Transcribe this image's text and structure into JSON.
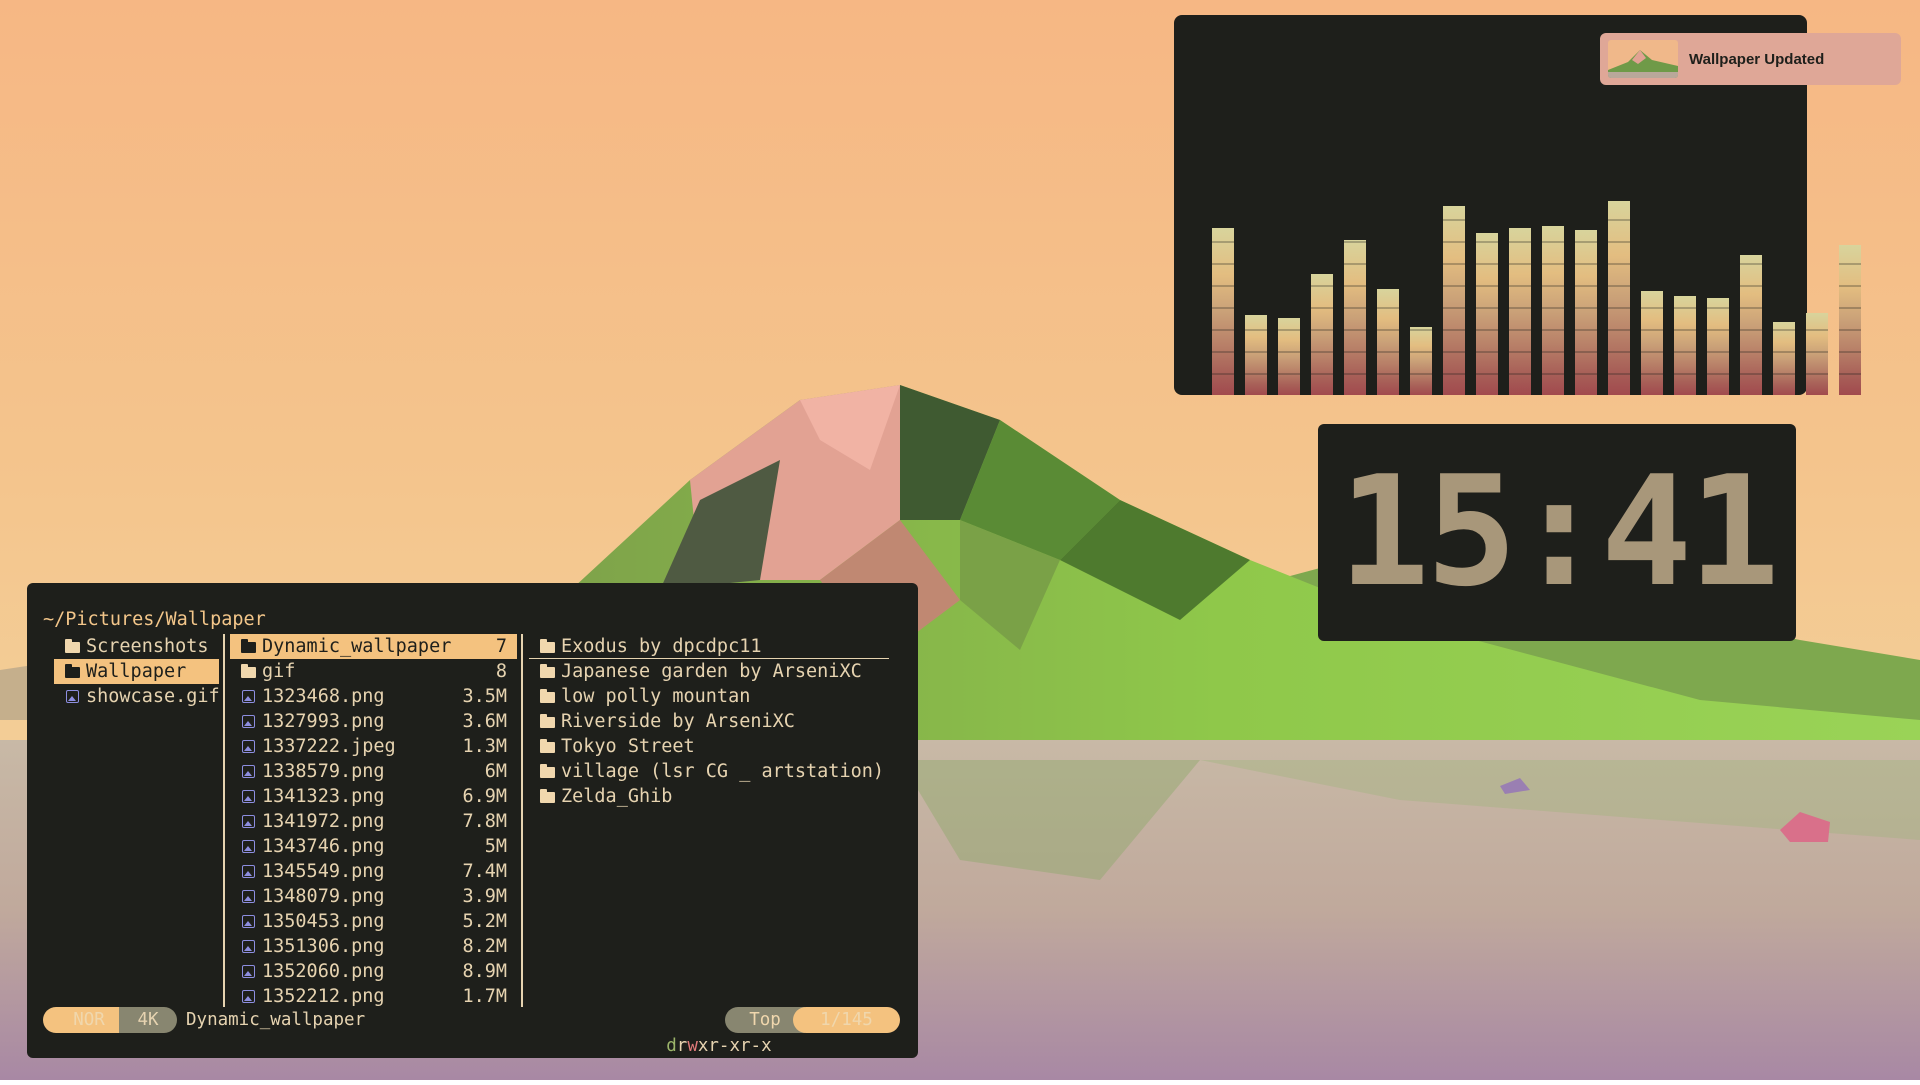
{
  "notification": {
    "text": "Wallpaper Updated",
    "thumbnail_icon": "wallpaper-thumbnail"
  },
  "clock": {
    "time": "15:41"
  },
  "visualizer": {
    "levels": [
      0.69,
      0.33,
      0.32,
      0.5,
      0.64,
      0.44,
      0.28,
      0.78,
      0.67,
      0.69,
      0.7,
      0.68,
      0.8,
      0.43,
      0.41,
      0.4,
      0.58,
      0.3,
      0.34,
      0.62
    ],
    "colors": {
      "top": "#d8d49c",
      "mid": "#e3bd80",
      "bottom": "#a14a4e"
    }
  },
  "file_manager": {
    "path": "~/Pictures/Wallpaper",
    "parent_column": [
      {
        "name": "Screenshots",
        "icon": "folder-icon",
        "selected": false
      },
      {
        "name": "Wallpaper",
        "icon": "folder-icon",
        "selected": true
      },
      {
        "name": "showcase.gif",
        "icon": "image-icon",
        "selected": false
      }
    ],
    "current_column": [
      {
        "name": "Dynamic_wallpaper",
        "size": "7",
        "icon": "folder-icon",
        "selected": true
      },
      {
        "name": "gif",
        "size": "8",
        "icon": "folder-icon",
        "selected": false
      },
      {
        "name": "1323468.png",
        "size": "3.5M",
        "icon": "image-icon",
        "selected": false
      },
      {
        "name": "1327993.png",
        "size": "3.6M",
        "icon": "image-icon",
        "selected": false
      },
      {
        "name": "1337222.jpeg",
        "size": "1.3M",
        "icon": "image-icon",
        "selected": false
      },
      {
        "name": "1338579.png",
        "size": "6M",
        "icon": "image-icon",
        "selected": false
      },
      {
        "name": "1341323.png",
        "size": "6.9M",
        "icon": "image-icon",
        "selected": false
      },
      {
        "name": "1341972.png",
        "size": "7.8M",
        "icon": "image-icon",
        "selected": false
      },
      {
        "name": "1343746.png",
        "size": "5M",
        "icon": "image-icon",
        "selected": false
      },
      {
        "name": "1345549.png",
        "size": "7.4M",
        "icon": "image-icon",
        "selected": false
      },
      {
        "name": "1348079.png",
        "size": "3.9M",
        "icon": "image-icon",
        "selected": false
      },
      {
        "name": "1350453.png",
        "size": "5.2M",
        "icon": "image-icon",
        "selected": false
      },
      {
        "name": "1351306.png",
        "size": "8.2M",
        "icon": "image-icon",
        "selected": false
      },
      {
        "name": "1352060.png",
        "size": "8.9M",
        "icon": "image-icon",
        "selected": false
      },
      {
        "name": "1352212.png",
        "size": "1.7M",
        "icon": "image-icon",
        "selected": false
      }
    ],
    "preview_column": [
      {
        "name": "Exodus by dpcdpc11",
        "icon": "folder-icon",
        "underlined": true
      },
      {
        "name": "Japanese garden by ArseniXC",
        "icon": "folder-icon"
      },
      {
        "name": "low polly mountan",
        "icon": "folder-icon"
      },
      {
        "name": "Riverside by ArseniXC",
        "icon": "folder-icon"
      },
      {
        "name": "Tokyo Street",
        "icon": "folder-icon"
      },
      {
        "name": "village (lsr CG _ artstation)",
        "icon": "folder-icon"
      },
      {
        "name": "Zelda_Ghib",
        "icon": "folder-icon"
      }
    ],
    "status": {
      "mode": "NOR",
      "size": "4K",
      "hovered": "Dynamic_wallpaper",
      "perm_d": "d",
      "perm_r": "r",
      "perm_w": "w",
      "perm_rest": "xr-xr-x",
      "position": "Top",
      "count": "1/145"
    }
  },
  "colors": {
    "panel": "#1e1f1b",
    "accent": "#f4c27f",
    "text": "#e6d3b0",
    "notification": "#dfa797",
    "clock_digits": "#a8977a"
  }
}
